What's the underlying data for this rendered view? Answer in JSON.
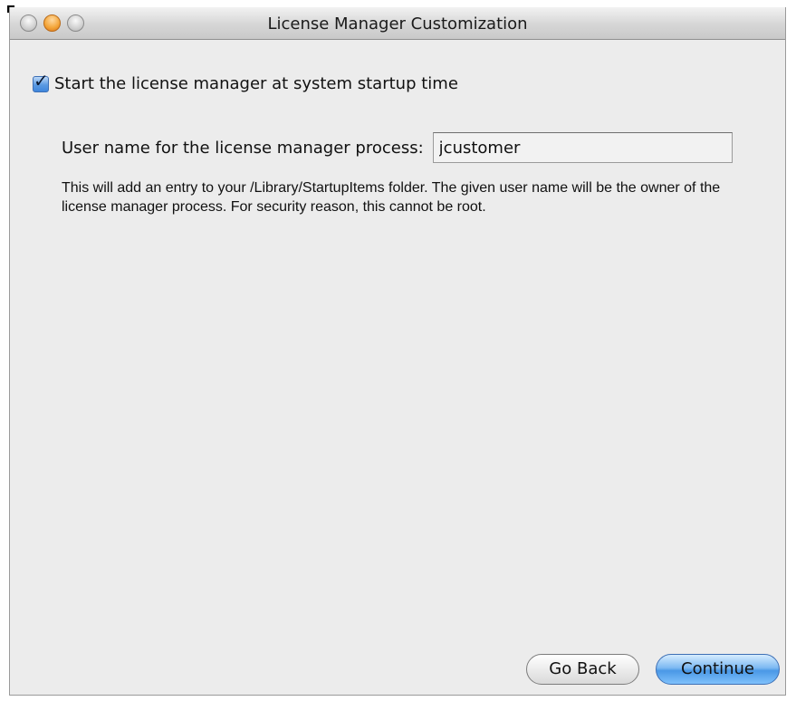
{
  "window": {
    "title": "License Manager Customization"
  },
  "form": {
    "startup_checkbox": {
      "label": "Start the license manager at system startup time",
      "checked": true
    },
    "username": {
      "label": "User name for the license manager process:",
      "value": "jcustomer"
    },
    "description": "This will add an entry to your /Library/StartupItems folder. The given user name will be the owner of the license manager process. For security reason, this cannot be root."
  },
  "buttons": {
    "back_label": "Go Back",
    "continue_label": "Continue"
  },
  "colors": {
    "accent": "#4a98e6",
    "window_background": "#ececec"
  },
  "icons": {
    "checkbox": "checkmark-icon"
  }
}
